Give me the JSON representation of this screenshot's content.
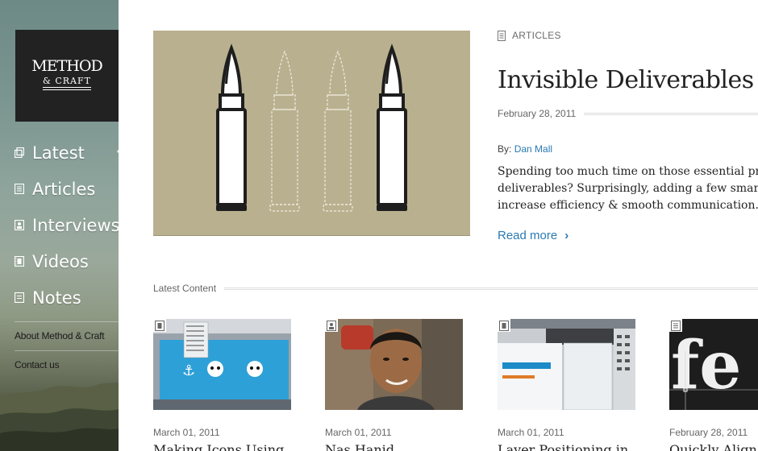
{
  "sidebar": {
    "logo": {
      "line1": "METHOD",
      "line2": "& CRAFT"
    },
    "nav": [
      {
        "label": "Latest",
        "icon": "latest-icon",
        "active": true
      },
      {
        "label": "Articles",
        "icon": "article-icon"
      },
      {
        "label": "Interviews",
        "icon": "interview-icon"
      },
      {
        "label": "Videos",
        "icon": "video-icon"
      },
      {
        "label": "Notes",
        "icon": "note-icon"
      }
    ],
    "links": [
      {
        "label": "About Method & Craft"
      },
      {
        "label": "Contact us"
      }
    ]
  },
  "hero": {
    "category": "ARTICLES",
    "title": "Invisible Deliverables",
    "date": "February 28, 2011",
    "by_prefix": "By:",
    "author": "Dan Mall",
    "excerpt_lines": [
      "Spending too much time on those essential projec",
      "deliverables? Surprisingly, adding a few smart st",
      "increase efficiency & smooth communication."
    ],
    "read_more": "Read more",
    "read_more_icon": "›"
  },
  "latest": {
    "heading": "Latest Content",
    "cards": [
      {
        "type_icon": "video-icon",
        "date": "March 01, 2011",
        "title": "Making Icons Using"
      },
      {
        "type_icon": "interview-icon",
        "date": "March 01, 2011",
        "title": "Nas Hanid"
      },
      {
        "type_icon": "video-icon",
        "date": "March 01, 2011",
        "title": "Layer Positioning in"
      },
      {
        "type_icon": "article-icon",
        "date": "February 28, 2011",
        "title": "Quickly Align"
      }
    ]
  },
  "colors": {
    "link": "#2a7ab3",
    "logo_bg": "#222222",
    "hero_bg": "#b9b08f"
  }
}
